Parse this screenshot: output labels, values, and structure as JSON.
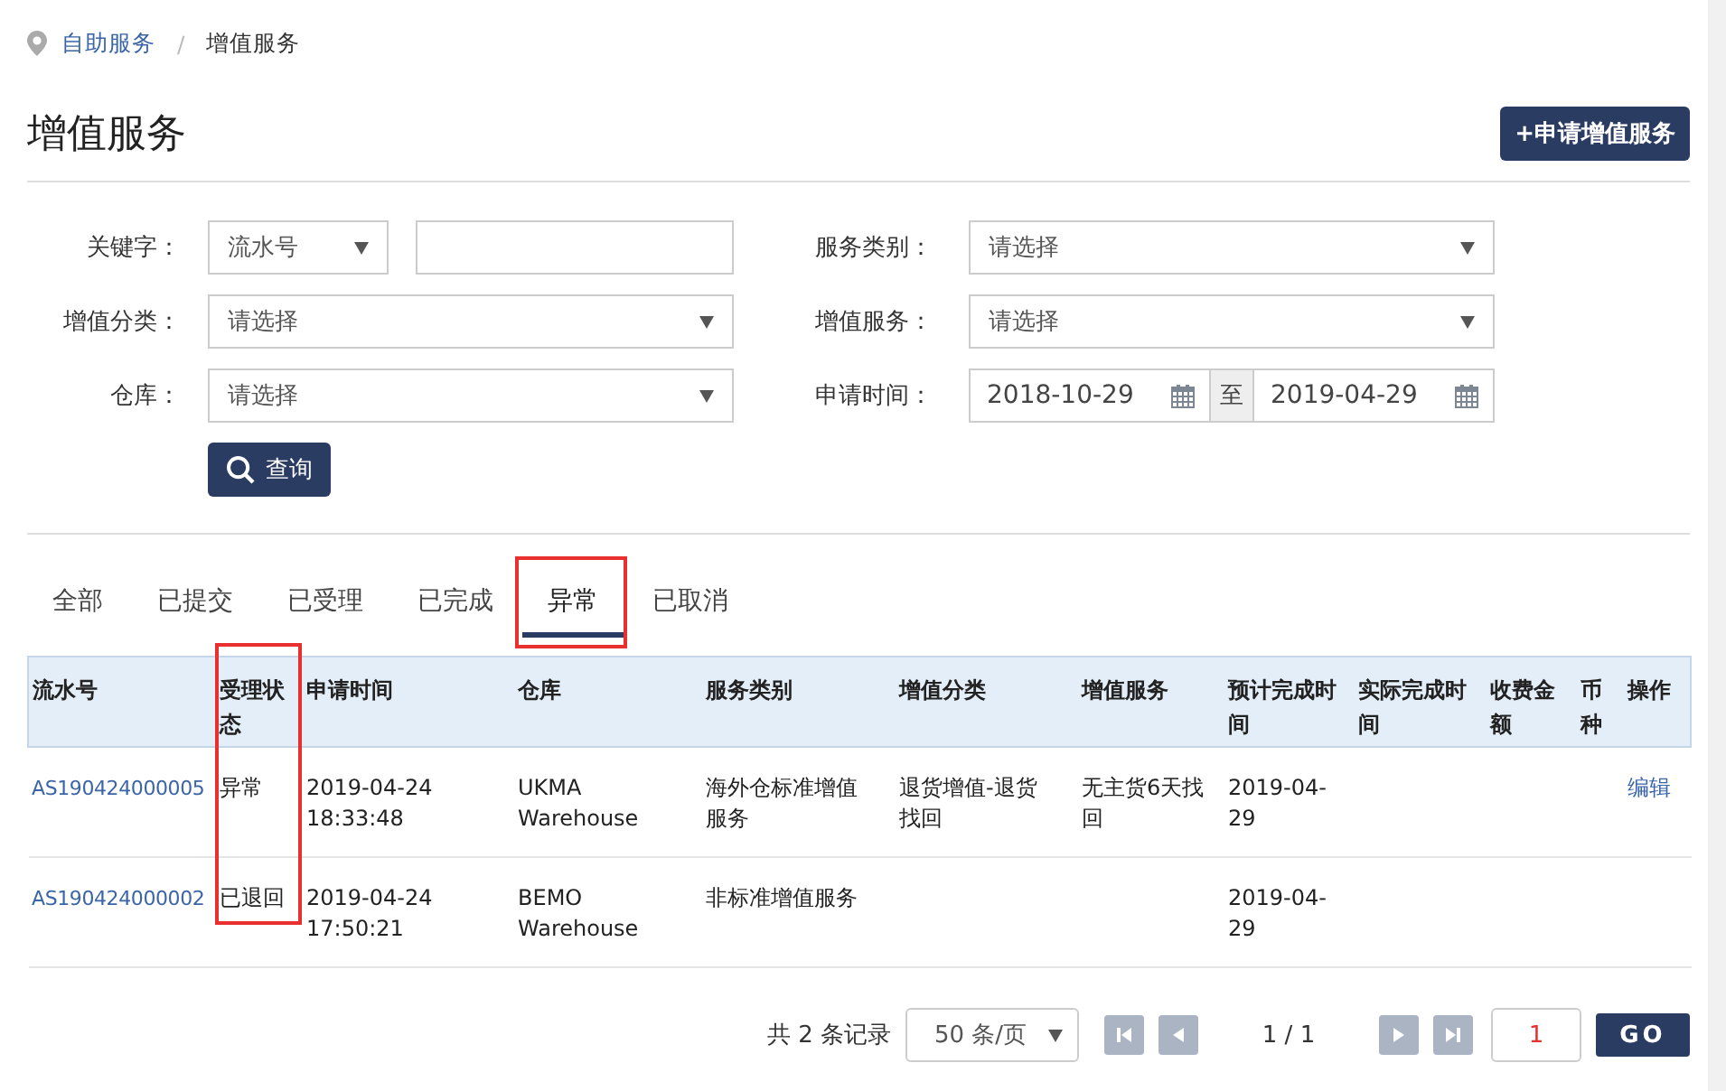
{
  "breadcrumb": [
    {
      "label": "自助服务",
      "link": true
    },
    {
      "label": "增值服务",
      "link": false
    }
  ],
  "breadcrumb_separator": "/",
  "title": "增值服务",
  "apply_button": "+申请增值服务",
  "filters": {
    "keyword": {
      "label": "关键字：",
      "type_value": "流水号"
    },
    "service_type": {
      "label": "服务类别：",
      "placeholder": "请选择"
    },
    "category": {
      "label": "增值分类：",
      "placeholder": "请选择"
    },
    "service": {
      "label": "增值服务：",
      "placeholder": "请选择"
    },
    "warehouse": {
      "label": "仓库：",
      "placeholder": "请选择"
    },
    "apply_time": {
      "label": "申请时间：",
      "from": "2018-10-29",
      "to_label": "至",
      "to": "2019-04-29"
    },
    "search_button": "查询"
  },
  "tabs": [
    {
      "label": "全部",
      "selected": false,
      "highlighted": false
    },
    {
      "label": "已提交",
      "selected": false,
      "highlighted": false
    },
    {
      "label": "已受理",
      "selected": false,
      "highlighted": false
    },
    {
      "label": "已完成",
      "selected": false,
      "highlighted": false
    },
    {
      "label": "异常",
      "selected": true,
      "highlighted": true
    },
    {
      "label": "已取消",
      "selected": false,
      "highlighted": false
    }
  ],
  "table": {
    "columns": [
      {
        "label": "流水号",
        "highlighted": false
      },
      {
        "label": "受理状态",
        "highlighted": true
      },
      {
        "label": "申请时间",
        "highlighted": false
      },
      {
        "label": "仓库",
        "highlighted": false
      },
      {
        "label": "服务类别",
        "highlighted": false
      },
      {
        "label": "增值分类",
        "highlighted": false
      },
      {
        "label": "增值服务",
        "highlighted": false
      },
      {
        "label": "预计完成时间",
        "highlighted": false
      },
      {
        "label": "实际完成时间",
        "highlighted": false
      },
      {
        "label": "收费金额",
        "highlighted": false
      },
      {
        "label": "币种",
        "highlighted": false
      },
      {
        "label": "操作",
        "highlighted": false
      }
    ],
    "rows": [
      {
        "serial": "AS190424000005",
        "status": "异常",
        "apply_time": "2019-04-24 18:33:48",
        "warehouse": "UKMA Warehouse",
        "service_type": "海外仓标准增值服务",
        "category": "退货增值-退货找回",
        "service": "无主货6天找回",
        "expected_time": "2019-04-29",
        "action": "编辑"
      },
      {
        "serial": "AS190424000002",
        "status": "已退回",
        "apply_time": "2019-04-24 17:50:21",
        "warehouse": "BEMO Warehouse",
        "service_type": "非标准增值服务",
        "expected_time": "2019-04-29"
      }
    ]
  },
  "pagination": {
    "total": "共 2 条记录",
    "page_size": "50 条/页",
    "page": "1 / 1",
    "page_input": "1",
    "go_button": "GO"
  }
}
